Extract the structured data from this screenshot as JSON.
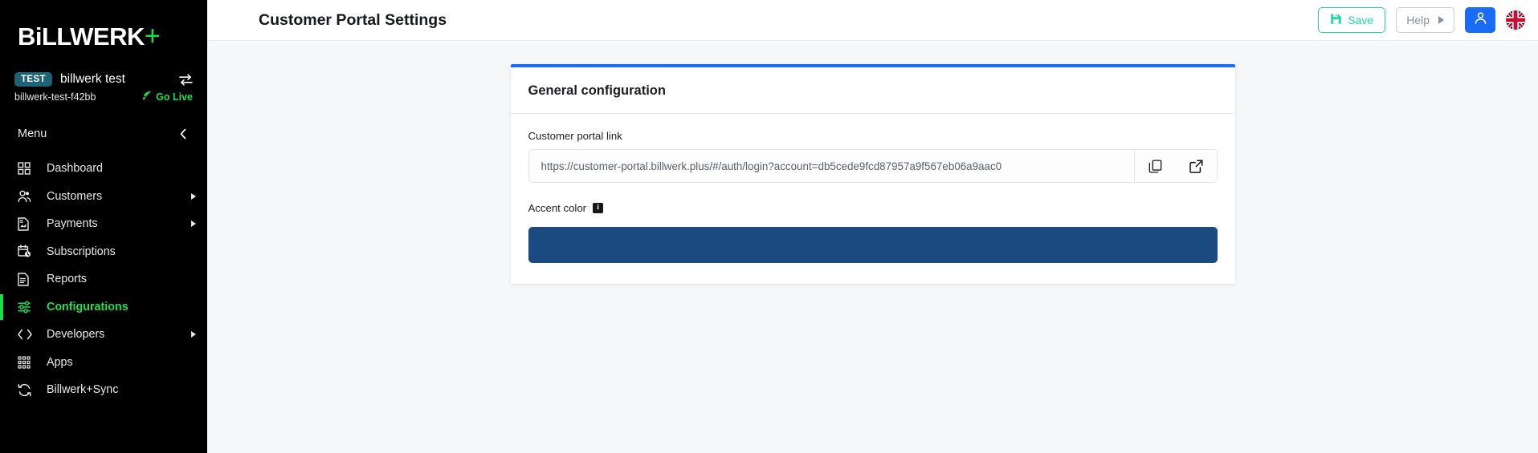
{
  "sidebar": {
    "brand": {
      "name": "BiLLWERK",
      "plus": "+"
    },
    "tenant": {
      "badge": "TEST",
      "name": "billwerk test",
      "slug": "billwerk-test-f42bb",
      "go_live": "Go Live",
      "switch_icon": "swap-arrows-icon",
      "rocket_icon": "rocket-icon"
    },
    "menu_label": "Menu",
    "collapse_icon": "chevron-left-icon",
    "items": [
      {
        "label": "Dashboard",
        "icon": "grid-squares-icon",
        "active": false,
        "expandable": false
      },
      {
        "label": "Customers",
        "icon": "users-icon",
        "active": false,
        "expandable": true
      },
      {
        "label": "Payments",
        "icon": "invoice-icon",
        "active": false,
        "expandable": true
      },
      {
        "label": "Subscriptions",
        "icon": "calendar-clock-icon",
        "active": false,
        "expandable": false
      },
      {
        "label": "Reports",
        "icon": "document-icon",
        "active": false,
        "expandable": false
      },
      {
        "label": "Configurations",
        "icon": "sliders-icon",
        "active": true,
        "expandable": false
      },
      {
        "label": "Developers",
        "icon": "code-brackets-icon",
        "active": false,
        "expandable": true
      },
      {
        "label": "Apps",
        "icon": "apps-dots-icon",
        "active": false,
        "expandable": false
      },
      {
        "label": "Billwerk+Sync",
        "icon": "sync-refresh-icon",
        "active": false,
        "expandable": false
      }
    ]
  },
  "header": {
    "title": "Customer Portal Settings",
    "save_label": "Save",
    "save_icon": "floppy-disk-save-icon",
    "help_label": "Help",
    "help_icon": "triangle-right-icon",
    "user_icon": "user-person-icon",
    "language_icon": "uk-flag-icon"
  },
  "card": {
    "title": "General configuration",
    "portal_link": {
      "label": "Customer portal link",
      "value": "https://customer-portal.billwerk.plus/#/auth/login?account=db5cede9fcd87957a9f567eb06a9aac0",
      "copy_icon": "copy-icon",
      "open_icon": "external-link-icon"
    },
    "accent_color": {
      "label": "Accent color",
      "info_icon": "info-icon",
      "info_glyph": "i",
      "value": "#1a4a80"
    }
  },
  "colors": {
    "brand_green": "#18e04a",
    "accent_blue": "#1a6cf5",
    "save_green": "#1fd8a4",
    "sidebar_bg": "#000000",
    "page_bg": "#f6f7f9",
    "swatch": "#1a4a80"
  }
}
